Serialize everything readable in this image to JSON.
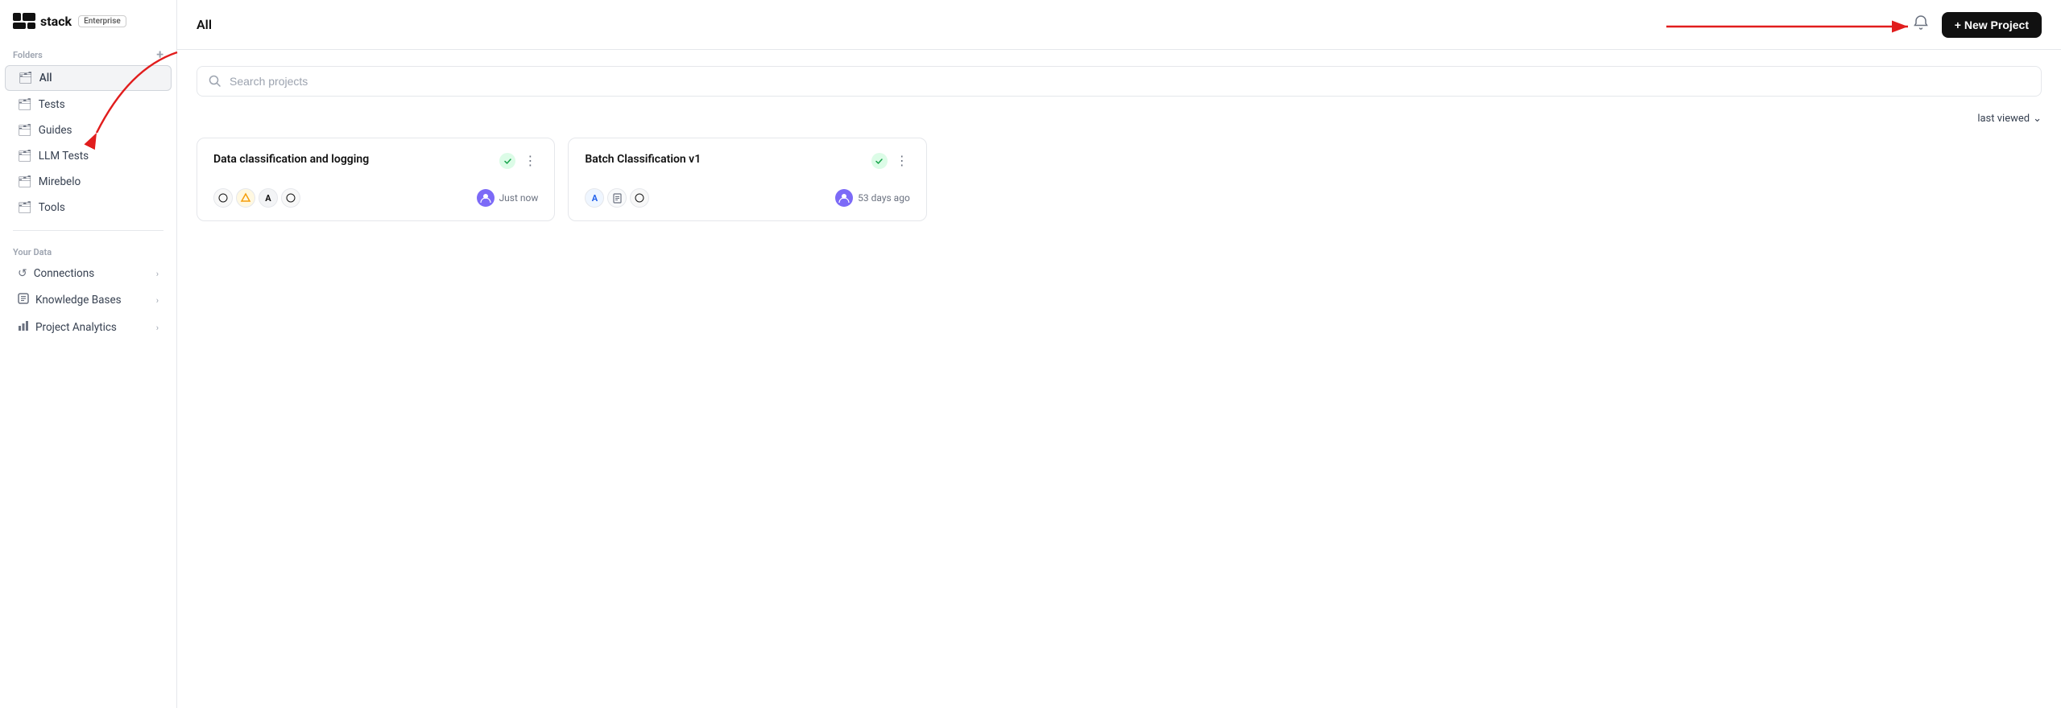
{
  "app": {
    "logo": "stack",
    "badge": "Enterprise"
  },
  "sidebar": {
    "folders_label": "Folders",
    "add_icon": "+",
    "items": [
      {
        "id": "all",
        "label": "All",
        "active": true
      },
      {
        "id": "tests",
        "label": "Tests"
      },
      {
        "id": "guides",
        "label": "Guides"
      },
      {
        "id": "llm-tests",
        "label": "LLM Tests"
      },
      {
        "id": "mirebelo",
        "label": "Mirebelo"
      },
      {
        "id": "tools",
        "label": "Tools"
      }
    ],
    "your_data_label": "Your Data",
    "data_items": [
      {
        "id": "connections",
        "label": "Connections",
        "has_chevron": true
      },
      {
        "id": "knowledge-bases",
        "label": "Knowledge Bases",
        "has_chevron": true
      },
      {
        "id": "project-analytics",
        "label": "Project Analytics",
        "has_chevron": true
      }
    ]
  },
  "header": {
    "title": "All",
    "bell_icon": "🔔",
    "new_project_label": "+ New Project"
  },
  "search": {
    "placeholder": "Search projects"
  },
  "sort": {
    "label": "last viewed",
    "chevron": "⌄"
  },
  "projects": [
    {
      "id": "data-classification",
      "title": "Data classification and logging",
      "status": "active",
      "icons": [
        "⚙",
        "🔸",
        "A",
        "⚙"
      ],
      "time": "Just now"
    },
    {
      "id": "batch-classification",
      "title": "Batch Classification v1",
      "status": "active",
      "icons": [
        "A",
        "📄",
        "⚙"
      ],
      "time": "53 days ago"
    }
  ]
}
